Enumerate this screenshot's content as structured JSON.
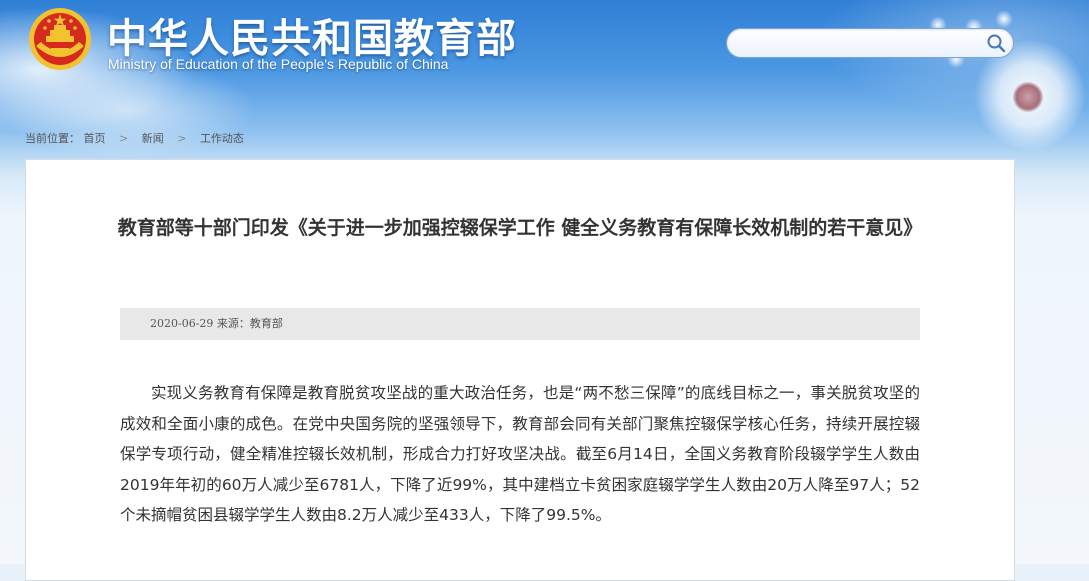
{
  "header": {
    "site_title": "中华人民共和国教育部",
    "site_subtitle": "Ministry of Education of the People's Republic of China",
    "search": {
      "value": "",
      "placeholder": ""
    },
    "icons": {
      "emblem": "national-emblem-icon",
      "search": "search-icon"
    }
  },
  "breadcrumb": {
    "prefix": "当前位置：",
    "items": [
      "首页",
      "新闻",
      "工作动态"
    ],
    "separator": ">"
  },
  "article": {
    "title": "教育部等十部门印发《关于进一步加强控辍保学工作 健全义务教育有保障长效机制的若干意见》",
    "date": "2020-06-29",
    "source_label": "来源：",
    "source": "教育部",
    "paragraph_1": "实现义务教育有保障是教育脱贫攻坚战的重大政治任务，也是“两不愁三保障”的底线目标之一，事关脱贫攻坚的成效和全面小康的成色。在党中央国务院的坚强领导下，教育部会同有关部门聚焦控辍保学核心任务，持续开展控辍保学专项行动，健全精准控辍长效机制，形成合力打好攻坚决战。截至6月14日，全国义务教育阶段辍学学生人数由2019年年初的60万人减少至6781人，下降了近99%，其中建档立卡贫困家庭辍学学生人数由20万人降至97人；52个未摘帽贫困县辍学学生人数由8.2万人减少至433人，下降了99.5%。"
  },
  "colors": {
    "sky_top": "#2f7fd6",
    "emblem_red": "#d62a1e",
    "emblem_gold": "#f2c230",
    "meta_bar_bg": "#e8e8e8",
    "text": "#333333"
  }
}
